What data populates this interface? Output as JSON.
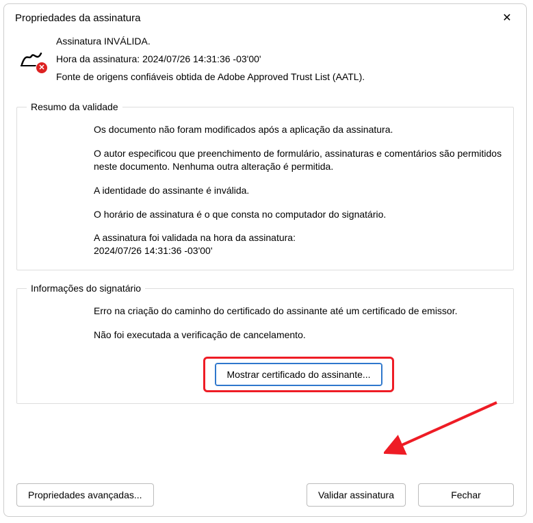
{
  "dialog": {
    "title": "Propriedades da assinatura",
    "close_glyph": "✕"
  },
  "header": {
    "status": "Assinatura INVÁLIDA.",
    "time_label": "Hora da assinatura:",
    "time_value": "2024/07/26 14:31:36 -03'00'",
    "trust_source": "Fonte de origens confiáveis obtida de Adobe Approved Trust List (AATL)."
  },
  "validity": {
    "legend": "Resumo da validade",
    "line_unmodified": "Os documento não foram modificados após a aplicação da assinatura.",
    "line_author": "O autor especificou que preenchimento de formulário, assinaturas e comentários são permitidos neste documento. Nenhuma outra alteração é permitida.",
    "line_identity": "A identidade do assinante é inválida.",
    "line_clock": "O horário de assinatura é o que consta no computador do signatário.",
    "line_validated1": "A assinatura foi validada na hora da assinatura:",
    "line_validated2": "2024/07/26 14:31:36 -03'00'"
  },
  "signer": {
    "legend": "Informações do signatário",
    "line_path_error": "Erro na criação do caminho do certificado do assinante até um certificado de emissor.",
    "line_revocation": "Não foi executada a verificação de cancelamento.",
    "show_cert_label": "Mostrar certificado do assinante..."
  },
  "buttons": {
    "advanced": "Propriedades avançadas...",
    "validate": "Validar assinatura",
    "close": "Fechar"
  },
  "icons": {
    "signature": "signature-pen-icon",
    "error_badge": "error-x-icon"
  },
  "annotation": {
    "arrow_color": "#ee1c25"
  }
}
